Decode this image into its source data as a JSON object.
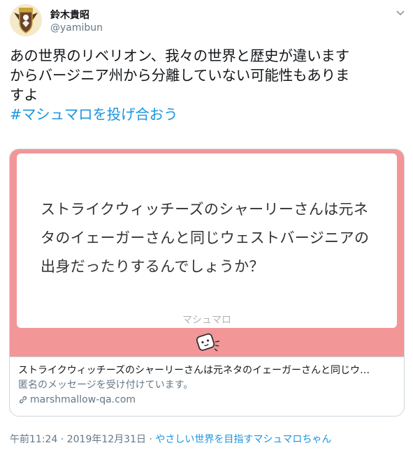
{
  "author": {
    "display_name": "鈴木貴昭",
    "handle": "@yamibun"
  },
  "tweet": {
    "text": "あの世界のリベリオン、我々の世界と歴史が違います\nからバージニア州から分離していない可能性もありま\nすよ",
    "hashtag": "#マシュマロを投げ合おう"
  },
  "card": {
    "question": "ストライクウィッチーズのシャーリーさんは元ネタのイェーガーさんと同じウェストバージニアの出身だったりするんでしょうか？",
    "service_label": "マシュマロ",
    "title": "ストライクウィッチーズのシャーリーさんは元ネタのイェーガーさんと同じウ…",
    "description": "匿名のメッセージを受け付けています。",
    "domain": "marshmallow-qa.com",
    "image_bg": "#f29698"
  },
  "meta": {
    "time": "午前11:24",
    "sep1": " · ",
    "date": "2019年12月31日",
    "sep2": " · ",
    "source": "やさしい世界を目指すマシュマロちゃん"
  }
}
